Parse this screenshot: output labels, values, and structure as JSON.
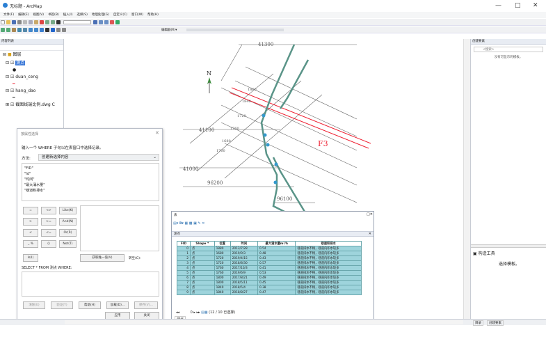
{
  "app": {
    "title": "无标题 - ArcMap",
    "win_min": "—",
    "win_max": "□",
    "win_close": "✕"
  },
  "menu": [
    "文件(F)",
    "编辑(E)",
    "视图(V)",
    "书签(B)",
    "插入(I)",
    "选择(S)",
    "地理处理(G)",
    "自定义(C)",
    "窗口(W)",
    "帮助(H)"
  ],
  "toolbar": {
    "editor_label": "编辑器(R)▾"
  },
  "toc": {
    "title": "内容列表",
    "root": "图层",
    "layers": [
      "测点",
      "duan_ceng",
      "hang_dao",
      "截图线端比例.dwg C"
    ]
  },
  "map": {
    "labels": [
      "41300",
      "41100",
      "41000",
      "96200",
      "96100",
      "F3",
      "1860",
      "1840",
      "1720",
      "1760",
      "1680",
      "1700",
      "N"
    ]
  },
  "right_panel": {
    "title": "创建要素",
    "search_placeholder": "<搜索>",
    "empty_msg": "没有可显示的模板。",
    "tools_title": "构造工具",
    "tools_msg": "选择模板。",
    "tab1": "目录",
    "tab2": "创建要素"
  },
  "select_dialog": {
    "title": "按属性选择",
    "instruction": "输入一个 WHERE 子句以在表窗口中选择记录。",
    "method_label": "方法:",
    "method_value": "创建新选择内容",
    "fields": [
      "\"FID\"",
      "\"Id\"",
      "\"时间\"",
      "\"最大涌水量\"",
      "\"巷道积排水\""
    ],
    "ops": [
      [
        "=",
        "<>",
        "Like(K)"
      ],
      [
        ">",
        ">=",
        "And(N)"
      ],
      [
        "<",
        "<=",
        "Or(R)"
      ],
      [
        "_ %",
        "()",
        "Not(T)"
      ]
    ],
    "is_label": "Is(I)",
    "unique_button": "获取唯一值(V)",
    "goto_label": "转至(G):",
    "sql_label": "SELECT * FROM 测点 WHERE:",
    "buttons": [
      "清除(E)",
      "验证(Y)",
      "帮助(H)",
      "加载(D)...",
      "保存(V)..."
    ],
    "apply": "应用",
    "close": "关闭"
  },
  "table": {
    "window_title": "表",
    "tab": "测点",
    "headers": [
      "FID",
      "Shape *",
      "位置",
      "时间",
      "最大涌水量m³/h",
      "巷道积排水"
    ],
    "rows": [
      [
        "0",
        "点",
        "1880",
        "2013/7/28",
        "0.54",
        "巷道排水不畅，巷道内积水较多"
      ],
      [
        "1",
        "点",
        "1680",
        "2019/9/3",
        "0.48",
        "巷道排水不畅，巷道内积水较多"
      ],
      [
        "2",
        "点",
        "1720",
        "2019/4/15",
        "0.43",
        "巷道排水不畅，巷道内积水较多"
      ],
      [
        "3",
        "点",
        "1720",
        "2018/8/30",
        "0.57",
        "巷道排水不畅，巷道内积水较多"
      ],
      [
        "4",
        "点",
        "1760",
        "2017/10/3",
        "0.41",
        "巷道排水不畅，巷道内积水较多"
      ],
      [
        "5",
        "点",
        "1760",
        "2019/6/9",
        "0.53",
        "巷道排水不畅，巷道内积水较多"
      ],
      [
        "6",
        "点",
        "1800",
        "2017/8/21",
        "0.49",
        "巷道排水不畅，巷道内积水较多"
      ],
      [
        "7",
        "点",
        "1800",
        "2018/5/11",
        "0.45",
        "巷道排水不畅，巷道内积水较多"
      ],
      [
        "8",
        "点",
        "1840",
        "2018/5/4",
        "0.38",
        "巷道排水不畅，巷道内积水较多"
      ],
      [
        "9",
        "点",
        "1840",
        "2018/8/27",
        "0.47",
        "巷道排水不畅，巷道内积水较多"
      ]
    ],
    "record_value": "0",
    "selected_text": "(12 / 10 已选择)",
    "footer_tab": "测点"
  }
}
